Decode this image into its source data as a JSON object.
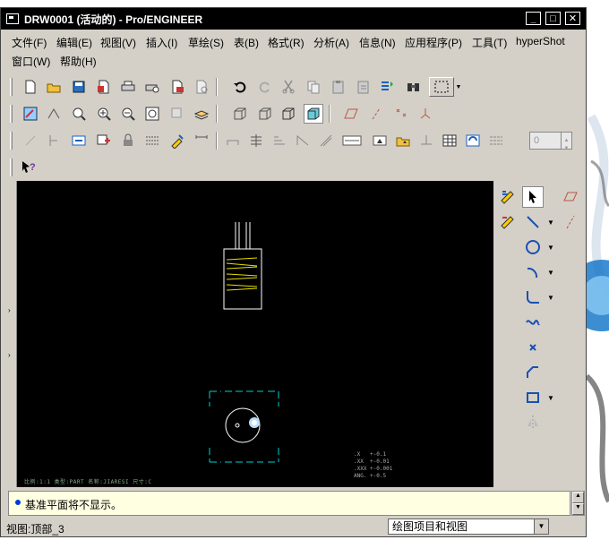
{
  "window": {
    "title": "DRW0001 (活动的) - Pro/ENGINEER",
    "minimize_glyph": "_",
    "maximize_glyph": "□",
    "close_glyph": "✕"
  },
  "menu": {
    "row1": [
      "文件(F)",
      "编辑(E)",
      "视图(V)",
      "插入(I)",
      "草绘(S)",
      "表(B)",
      "格式(R)",
      "分析(A)",
      "信息(N)",
      "应用程序(P)",
      "工具(T)",
      "hyperShot"
    ],
    "row2": [
      "窗口(W)",
      "帮助(H)"
    ]
  },
  "toolbar": {
    "spin_value": "0"
  },
  "graphics": {
    "footer_text": "比例:1:1   类型:PART   名称:JIARESI   尺寸:C",
    "tolerance_text": ".X   +-0.1\n.XX  +-0.01\n.XXX +-0.001\nANG. +-0.5"
  },
  "message": {
    "text": "基准平面将不显示。"
  },
  "status": {
    "view_label": "视图:顶部_3",
    "filter_value": "绘图项目和视图"
  }
}
